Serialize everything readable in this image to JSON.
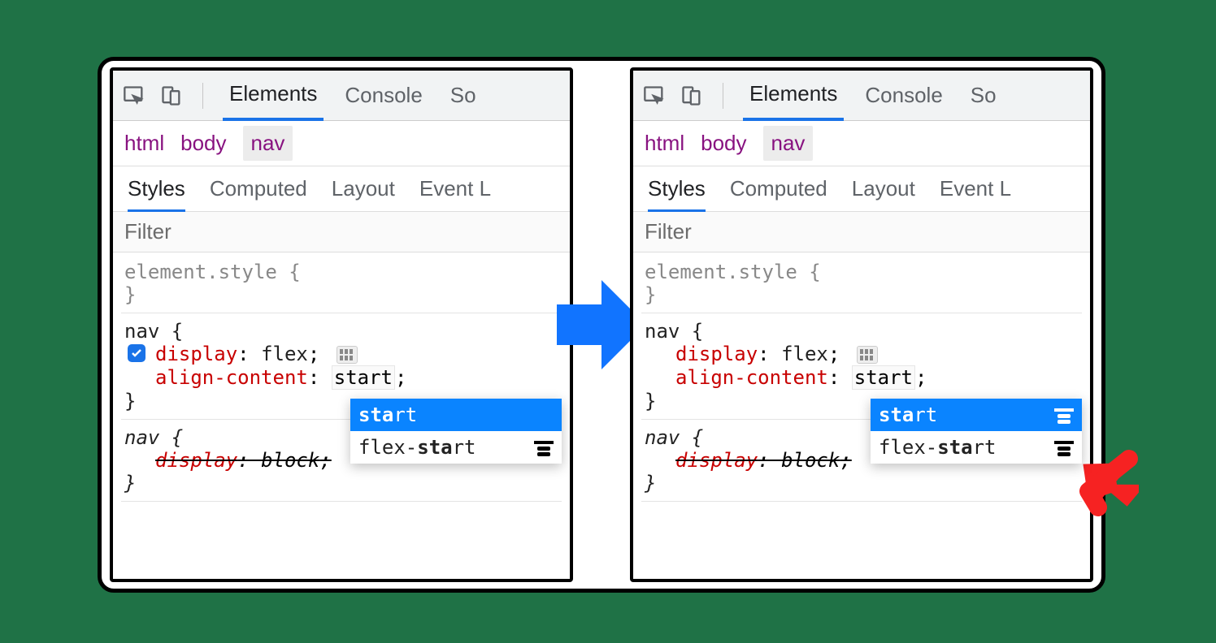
{
  "topTabs": {
    "elements": "Elements",
    "console": "Console",
    "sources": "So"
  },
  "crumbs": {
    "html": "html",
    "body": "body",
    "nav": "nav"
  },
  "subtabs": {
    "styles": "Styles",
    "computed": "Computed",
    "layout": "Layout",
    "events": "Event L"
  },
  "filter": {
    "placeholder": "Filter"
  },
  "rules": {
    "elementStyle": "element.style {",
    "closeBrace": "}",
    "navOpen": "nav {",
    "display": {
      "name": "display",
      "sep": ": ",
      "value": "flex",
      "semi": ";"
    },
    "alignContent": {
      "name": "align-content",
      "sep": ": ",
      "value": "start",
      "semi": ";"
    },
    "navItalic": "nav {",
    "overridden": {
      "name": "display",
      "sep": ": ",
      "value": "block",
      "semi": ";"
    }
  },
  "autocomplete": {
    "opt1": {
      "bold": "sta",
      "rest": "rt"
    },
    "opt2": {
      "pre": "flex-",
      "bold": "sta",
      "rest": "rt"
    }
  },
  "colors": {
    "tabBlue": "#1a73e8",
    "arrowBlue": "#1a73e8",
    "arrowRed": "#f62222",
    "crumbPurple": "#881280",
    "propRed": "#c80000"
  }
}
